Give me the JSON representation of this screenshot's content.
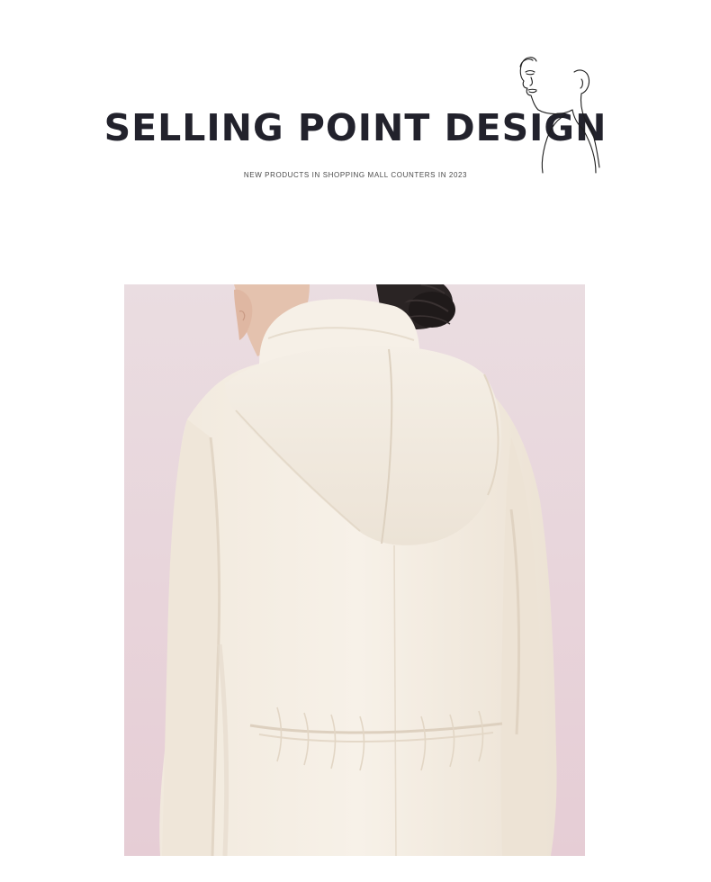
{
  "header": {
    "title": "SELLING POINT DESIGN",
    "subtitle": "NEW PRODUCTS IN SHOPPING MALL COUNTERS IN 2023"
  },
  "decoration": {
    "icon": "face-line-art-icon"
  },
  "product_photo": {
    "icon": "hooded-coat-back-photo",
    "colors": {
      "background": "#e9d7dd",
      "coat": "#f4ede3",
      "coat_shadow": "#e3d8ca",
      "hair": "#262222",
      "skin": "#e8c7b4"
    }
  },
  "colors": {
    "title_text": "#22222c",
    "subtitle_text": "#4a4a4a",
    "page_background": "#ffffff"
  }
}
